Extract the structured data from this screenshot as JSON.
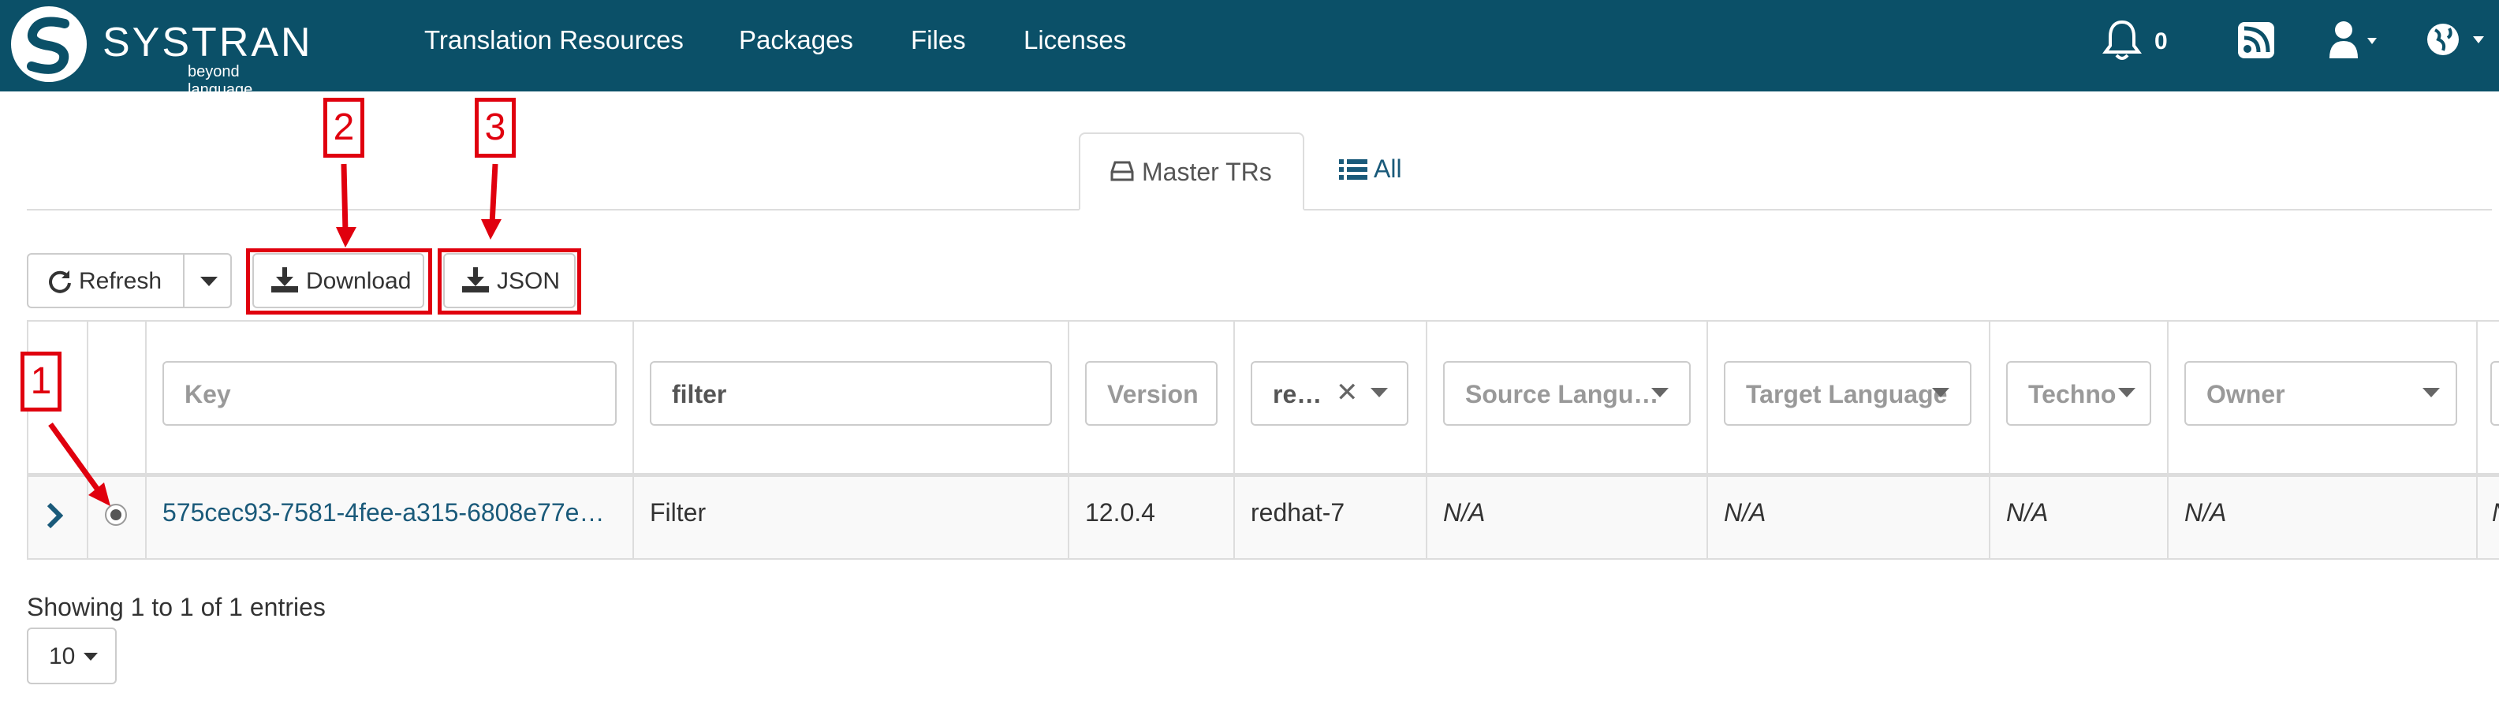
{
  "brand": {
    "name": "SYSTRAN",
    "tagline": "beyond language",
    "color": "#0b5068"
  },
  "nav": {
    "links": [
      "Translation Resources",
      "Packages",
      "Files",
      "Licenses"
    ],
    "notifications_count": "0",
    "icons": [
      "bell-icon",
      "rss-icon",
      "user-icon",
      "globe-icon"
    ]
  },
  "tabs": {
    "master_label": "Master TRs",
    "all_label": "All"
  },
  "toolbar": {
    "refresh_label": "Refresh",
    "download_label": "Download",
    "json_label": "JSON"
  },
  "callouts": [
    "1",
    "2",
    "3"
  ],
  "filters": {
    "key_placeholder": "Key",
    "type_value": "filter",
    "version_placeholder": "Version",
    "platform_value": "re…",
    "source_placeholder": "Source Langu…",
    "target_placeholder": "Target Language",
    "techno_placeholder": "Techno",
    "owner_placeholder": "Owner"
  },
  "rows": [
    {
      "key": "575cec93-7581-4fee-a315-6808e77e…",
      "type": "Filter",
      "version": "12.0.4",
      "platform": "redhat-7",
      "source": "N/A",
      "target": "N/A",
      "techno": "N/A",
      "owner": "N/A",
      "extra": "N/A"
    }
  ],
  "footer": {
    "summary": "Showing 1 to 1 of 1 entries",
    "page_size": "10"
  },
  "colors": {
    "accent_red": "#e0000e",
    "link": "#1a5a7a"
  }
}
